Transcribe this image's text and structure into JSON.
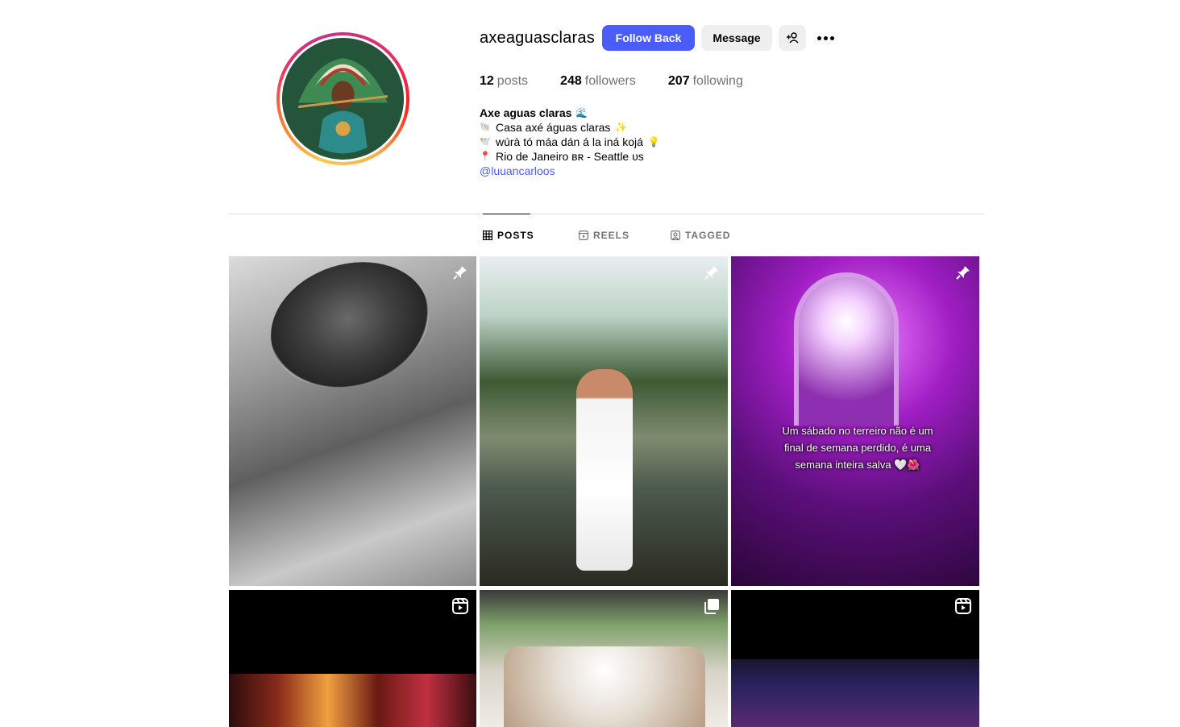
{
  "profile": {
    "username": "axeaguasclaras",
    "follow_back_label": "Follow Back",
    "message_label": "Message",
    "stats": {
      "posts_count": "12",
      "posts_label": "posts",
      "followers_count": "248",
      "followers_label": "followers",
      "following_count": "207",
      "following_label": "following"
    },
    "bio": {
      "name": "Axe aguas claras",
      "name_emoji": "🌊",
      "line1_emoji": "🐚",
      "line1": "Casa axé águas claras",
      "line1_suffix": "✨",
      "line2_emoji": "🕊️",
      "line2": "wúrà tó máa dán á la iná kojá",
      "line2_suffix": "💡",
      "line3_emoji": "📍",
      "line3": "Rio de Janeiro ʙʀ - Seattle ᴜs",
      "mention": "@luuancarloos"
    }
  },
  "tabs": [
    {
      "label": "POSTS",
      "icon": "grid-icon",
      "active": true
    },
    {
      "label": "REELS",
      "icon": "reels-icon",
      "active": false
    },
    {
      "label": "TAGGED",
      "icon": "tagged-icon",
      "active": false
    }
  ],
  "posts": [
    {
      "badge": "pin-icon"
    },
    {
      "badge": "pin-icon"
    },
    {
      "badge": "pin-icon",
      "caption": "Um sábado no terreiro não é um final de semana perdido, é uma semana inteira salva 🤍🌺"
    },
    {
      "badge": "reel-icon"
    },
    {
      "badge": "carousel-icon"
    },
    {
      "badge": "reel-icon"
    }
  ],
  "colors": {
    "accent": "#4a5df9",
    "muted_text": "#737373",
    "button_gray": "#efefef",
    "divider": "#dbdbdb"
  }
}
